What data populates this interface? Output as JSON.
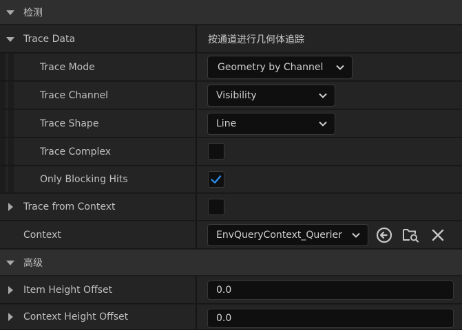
{
  "sections": {
    "detection": {
      "title": "检测"
    },
    "advanced": {
      "title": "高级"
    }
  },
  "trace_data": {
    "label": "Trace Data",
    "value": "按通道进行几何体追踪"
  },
  "trace_mode": {
    "label": "Trace Mode",
    "value": "Geometry by Channel"
  },
  "trace_channel": {
    "label": "Trace Channel",
    "value": "Visibility"
  },
  "trace_shape": {
    "label": "Trace Shape",
    "value": "Line"
  },
  "trace_complex": {
    "label": "Trace Complex",
    "checked": false
  },
  "only_blocking_hits": {
    "label": "Only Blocking Hits",
    "checked": true
  },
  "trace_from_context": {
    "label": "Trace from Context",
    "checked": false
  },
  "context": {
    "label": "Context",
    "value": "EnvQueryContext_Querier"
  },
  "item_height_offset": {
    "label": "Item Height Offset",
    "value": "0.0"
  },
  "context_height_offset": {
    "label": "Context Height Offset",
    "value": "0.0"
  },
  "icons": {
    "use": "arrow-left-circle-icon",
    "browse": "folder-search-icon",
    "clear": "close-icon",
    "checkmark": "checkmark-icon",
    "expand": "chevron-down-icon"
  },
  "colors": {
    "accent_check": "#2b8be8",
    "background": "#1a1a1a",
    "section": "#2f2f2f",
    "row": "#242424"
  }
}
